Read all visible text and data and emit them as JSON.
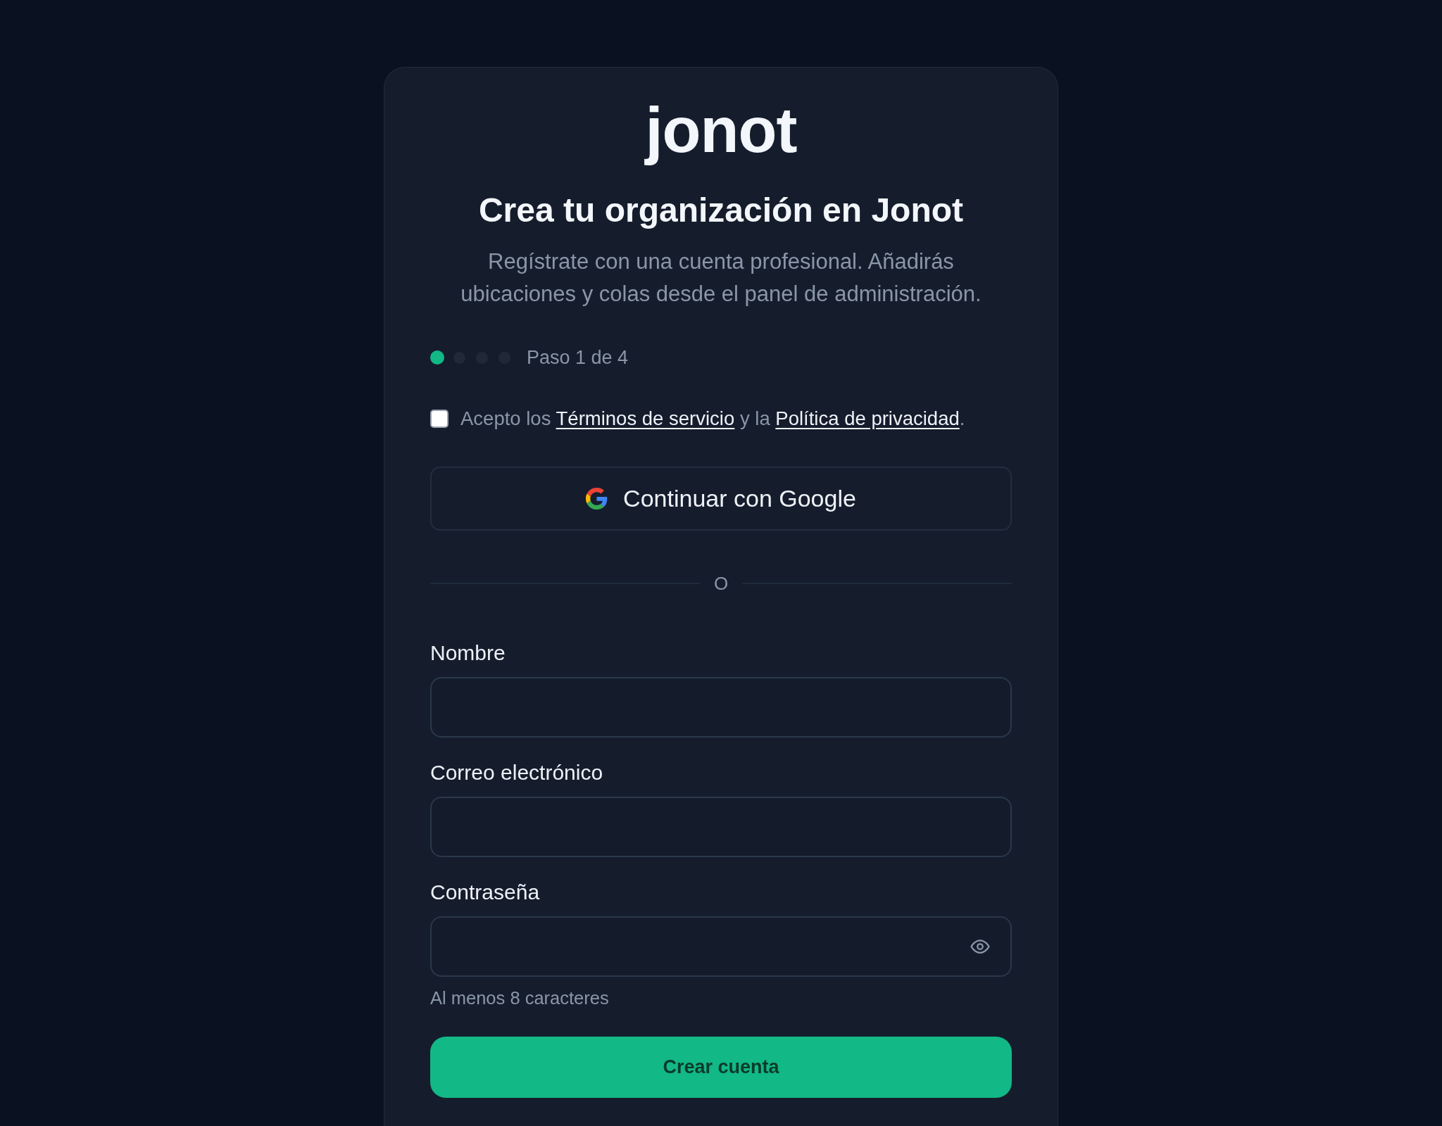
{
  "logo": {
    "text": "jonot"
  },
  "heading": "Crea tu organización en Jonot",
  "subtitle": "Regístrate con una cuenta profesional. Añadirás ubicaciones y colas desde el panel de administración.",
  "steps": {
    "dots": [
      {
        "active": true
      },
      {
        "active": false
      },
      {
        "active": false
      },
      {
        "active": false
      }
    ],
    "label": "Paso 1 de 4"
  },
  "terms": {
    "checked": false,
    "parts": [
      {
        "kind": "text",
        "text": "Acepto los "
      },
      {
        "kind": "link",
        "text": "Términos de servicio"
      },
      {
        "kind": "text",
        "text": " y la "
      },
      {
        "kind": "link",
        "text": "Política de privacidad"
      },
      {
        "kind": "text",
        "text": "."
      }
    ]
  },
  "google_button": {
    "label": "Continuar con Google"
  },
  "divider": {
    "text": "O"
  },
  "fields": [
    {
      "kind": "text",
      "label": "Nombre"
    },
    {
      "kind": "email",
      "label": "Correo electrónico"
    },
    {
      "kind": "password",
      "label": "Contraseña",
      "hint": "Al menos 8 caracteres"
    }
  ],
  "submit": {
    "label": "Crear cuenta"
  }
}
